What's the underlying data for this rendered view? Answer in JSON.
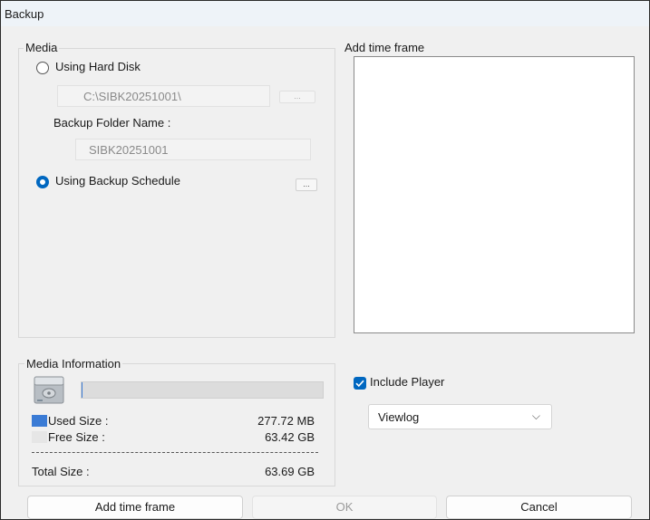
{
  "window": {
    "title": "Backup"
  },
  "media": {
    "legend": "Media",
    "hard_disk": {
      "label": "Using Hard Disk",
      "selected": false
    },
    "path_value": "C:\\SIBK20251001\\",
    "browse_label": "...",
    "folder_name_label": "Backup Folder Name :",
    "folder_name_value": "SIBK20251001",
    "schedule": {
      "label": "Using Backup Schedule",
      "selected": true
    },
    "schedule_btn_label": "..."
  },
  "time_frame": {
    "legend": "Add time frame",
    "items": []
  },
  "media_info": {
    "legend": "Media Information",
    "icon": "hard-drive-icon",
    "usage_fraction": 0.0043,
    "used_label": "Used Size :",
    "used_value": "277.72 MB",
    "used_color": "#3a7bd5",
    "free_label": "Free Size :",
    "free_value": "63.42 GB",
    "free_color": "#e6e6e6",
    "total_label": "Total Size :",
    "total_value": "63.69 GB"
  },
  "options": {
    "include_player_label": "Include Player",
    "include_player_checked": true,
    "player_select_value": "Viewlog"
  },
  "buttons": {
    "add_time_frame": "Add time frame",
    "ok": "OK",
    "cancel": "Cancel"
  },
  "colors": {
    "accent": "#0067c0"
  }
}
